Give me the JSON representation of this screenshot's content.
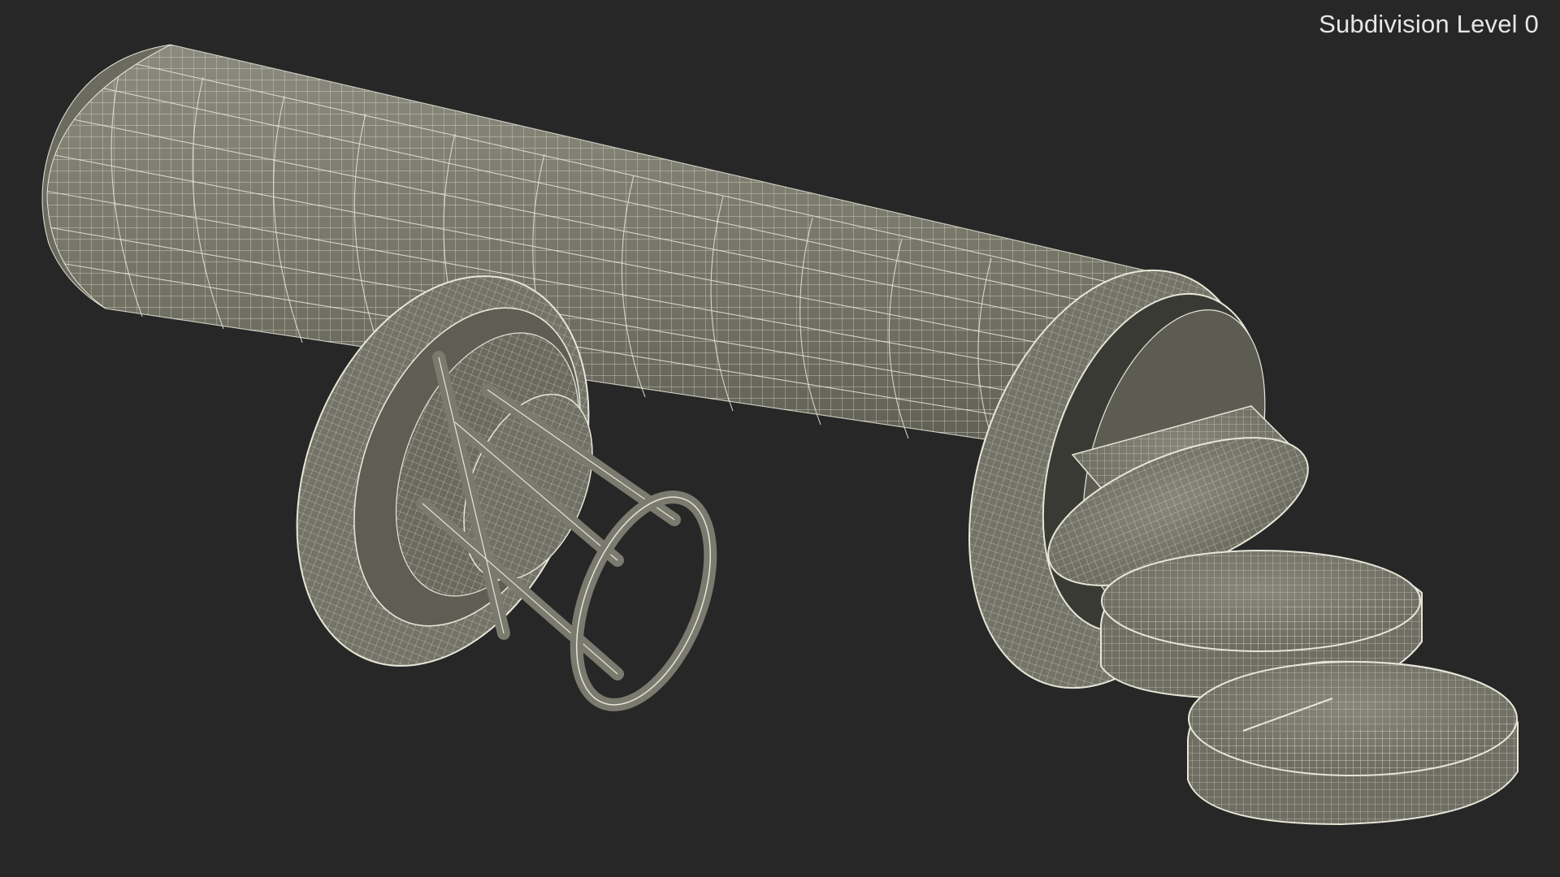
{
  "viewport": {
    "overlay_label": "Subdivision Level 0",
    "background_color": "#272727",
    "mesh_fill_color": "#7a7a6e",
    "wire_color": "#e8e8da",
    "scene_content": "wireframe-render"
  }
}
